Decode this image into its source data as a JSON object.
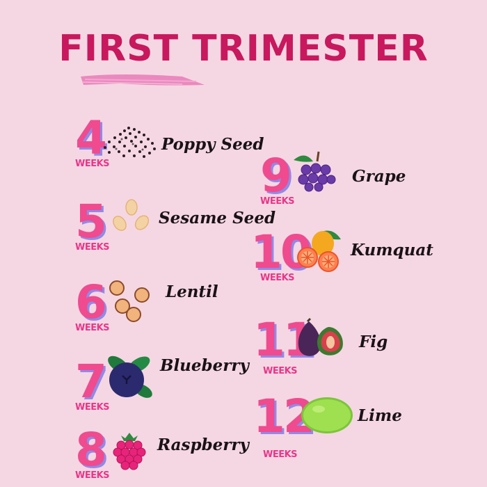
{
  "title": "FIRST TRIMESTER",
  "week_label": "WEEKS",
  "colors": {
    "title": "#c8185e",
    "number": "#ef4b8e",
    "number_shadow": "#8f8ae8",
    "background": "#f5d7e3"
  },
  "weeks": [
    {
      "number": "4",
      "fruit": "Poppy Seed",
      "icon": "poppy-seed-icon"
    },
    {
      "number": "5",
      "fruit": "Sesame Seed",
      "icon": "sesame-seed-icon"
    },
    {
      "number": "6",
      "fruit": "Lentil",
      "icon": "lentil-icon"
    },
    {
      "number": "7",
      "fruit": "Blueberry",
      "icon": "blueberry-icon"
    },
    {
      "number": "8",
      "fruit": "Raspberry",
      "icon": "raspberry-icon"
    },
    {
      "number": "9",
      "fruit": "Grape",
      "icon": "grape-icon"
    },
    {
      "number": "10",
      "fruit": "Kumquat",
      "icon": "kumquat-icon"
    },
    {
      "number": "11",
      "fruit": "Fig",
      "icon": "fig-icon"
    },
    {
      "number": "12",
      "fruit": "Lime",
      "icon": "lime-icon"
    }
  ]
}
